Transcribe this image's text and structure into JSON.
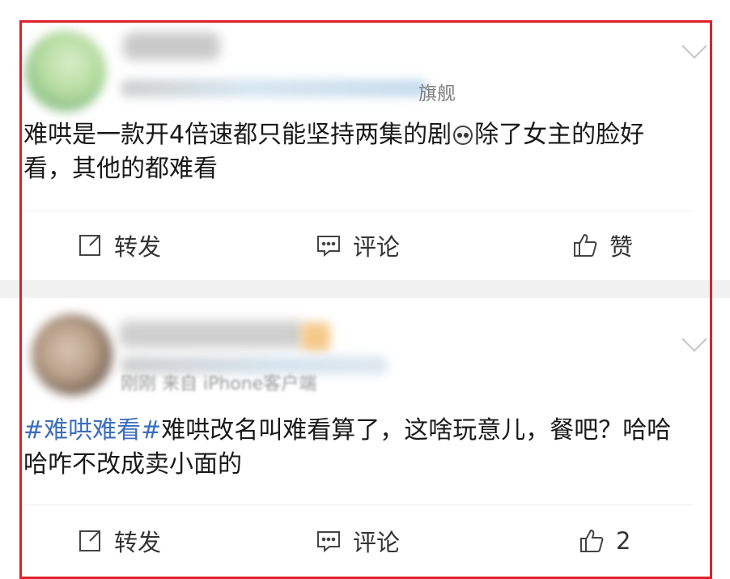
{
  "posts": [
    {
      "meta_suffix": "旗舰",
      "meta_time": "刚刚",
      "meta_source": "来自",
      "content": [
        {
          "type": "text",
          "value": "难哄是一款开4倍速都只能坚持两集的剧"
        },
        {
          "type": "emoji",
          "name": "panda-emoji"
        },
        {
          "type": "text",
          "value": "除了女主的脸好看，其他的都难看"
        }
      ],
      "actions": {
        "repost": "转发",
        "comment": "评论",
        "like": "赞"
      }
    },
    {
      "meta_line": "刚刚 来自 iPhone客户端",
      "content": [
        {
          "type": "hashtag",
          "value": "#难哄难看#"
        },
        {
          "type": "text",
          "value": "难哄改名叫难看算了，这啥玩意儿，餐吧？哈哈哈咋不改成卖小面的"
        }
      ],
      "actions": {
        "repost": "转发",
        "comment": "评论",
        "like": "2"
      }
    }
  ],
  "icons": {
    "repost": "repost-icon",
    "comment": "comment-icon",
    "like": "thumbs-up-icon",
    "more": "chevron-down-icon"
  },
  "colors": {
    "highlight_border": "#e0202a",
    "hashtag": "#3b6ebb",
    "text": "#1a1a1a",
    "separator": "#f1f1f1"
  }
}
